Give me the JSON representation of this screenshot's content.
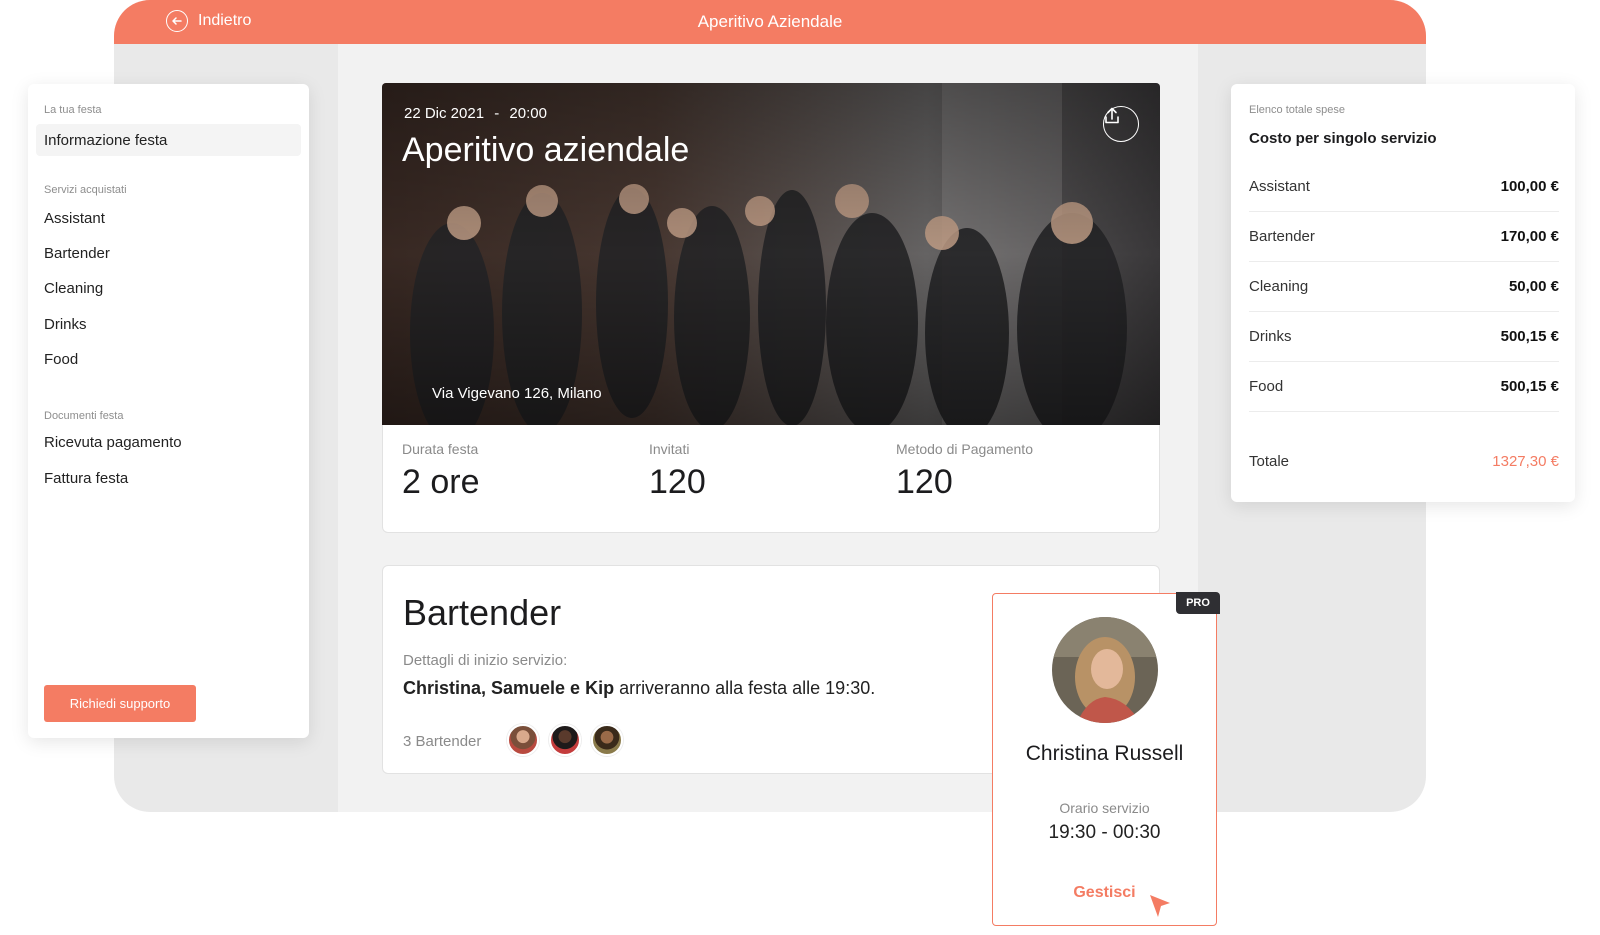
{
  "header": {
    "back_label": "Indietro",
    "title": "Aperitivo Aziendale"
  },
  "sidebar": {
    "section_party": "La tua festa",
    "active_item": "Informazione festa",
    "section_services": "Servizi acquistati",
    "services": [
      "Assistant",
      "Bartender",
      "Cleaning",
      "Drinks",
      "Food"
    ],
    "section_docs": "Documenti festa",
    "docs": [
      "Ricevuta pagamento",
      "Fattura festa"
    ],
    "support_button": "Richiedi supporto"
  },
  "event": {
    "date": "22 Dic 2021",
    "separator": "-",
    "time": "20:00",
    "title": "Aperitivo aziendale",
    "address": "Via Vigevano 126, Milano",
    "upload_icon": "upload-icon"
  },
  "stats": [
    {
      "label": "Durata festa",
      "value": "2 ore"
    },
    {
      "label": "Invitati",
      "value": "120"
    },
    {
      "label": "Metodo di Pagamento",
      "value": "120"
    }
  ],
  "bartender": {
    "title": "Bartender",
    "subtitle": "Dettagli di inizio servizio:",
    "names": "Christina, Samuele e Kip",
    "sentence_rest": " arriveranno alla festa alle 19:30.",
    "count_label": "3 Bartender"
  },
  "person_card": {
    "badge": "PRO",
    "name": "Christina Russell",
    "schedule_label": "Orario servizio",
    "schedule_value": "19:30 - 00:30",
    "manage_button": "Gestisci"
  },
  "expenses": {
    "section": "Elenco totale spese",
    "title": "Costo per singolo servizio",
    "rows": [
      {
        "name": "Assistant",
        "value": "100,00 €"
      },
      {
        "name": "Bartender",
        "value": "170,00 €"
      },
      {
        "name": "Cleaning",
        "value": "50,00 €"
      },
      {
        "name": "Drinks",
        "value": "500,15 €"
      },
      {
        "name": "Food",
        "value": "500,15 €"
      }
    ],
    "total_label": "Totale",
    "total_value": "1327,30 €"
  },
  "colors": {
    "accent": "#f47c63",
    "badge_dark": "#2f2f33"
  }
}
